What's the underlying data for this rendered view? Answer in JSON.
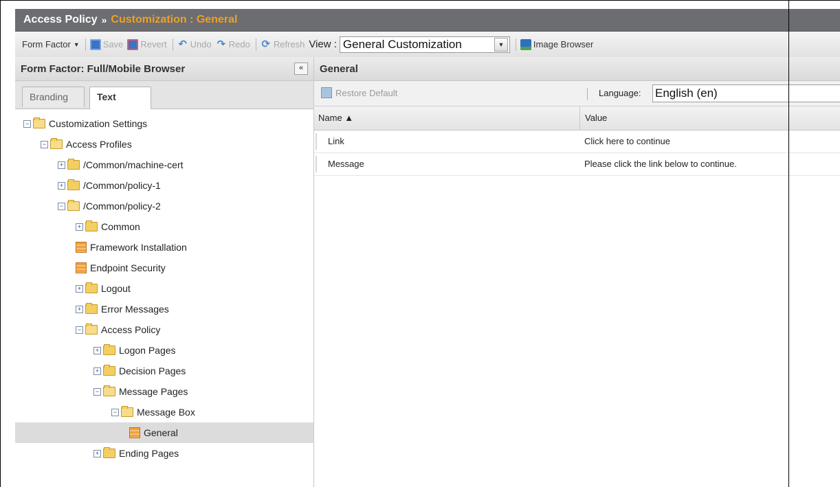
{
  "titlebar": {
    "section": "Access Policy",
    "separator": "»",
    "page": "Customization : General"
  },
  "toolbar": {
    "form_factor": "Form Factor",
    "save": "Save",
    "revert": "Revert",
    "undo": "Undo",
    "redo": "Redo",
    "refresh": "Refresh",
    "view_label": "View :",
    "view_value": "General Customization",
    "image_browser": "Image Browser"
  },
  "left_panel": {
    "title": "Form Factor: Full/Mobile Browser",
    "collapse_glyph": "«",
    "tabs": [
      "Branding",
      "Text"
    ],
    "active_tab": "Text"
  },
  "tree": [
    {
      "label": "Customization Settings",
      "level": 0,
      "type": "folder",
      "expanded": true
    },
    {
      "label": "Access Profiles",
      "level": 1,
      "type": "folder",
      "expanded": true
    },
    {
      "label": "/Common/machine-cert",
      "level": 2,
      "type": "folder",
      "expanded": false
    },
    {
      "label": "/Common/policy-1",
      "level": 2,
      "type": "folder",
      "expanded": false
    },
    {
      "label": "/Common/policy-2",
      "level": 2,
      "type": "folder",
      "expanded": true
    },
    {
      "label": "Common",
      "level": 3,
      "type": "folder",
      "expanded": false
    },
    {
      "label": "Framework Installation",
      "level": 3,
      "type": "page"
    },
    {
      "label": "Endpoint Security",
      "level": 3,
      "type": "page"
    },
    {
      "label": "Logout",
      "level": 3,
      "type": "folder",
      "expanded": false
    },
    {
      "label": "Error Messages",
      "level": 3,
      "type": "folder",
      "expanded": false
    },
    {
      "label": "Access Policy",
      "level": 3,
      "type": "folder",
      "expanded": true
    },
    {
      "label": "Logon Pages",
      "level": 4,
      "type": "folder",
      "expanded": false
    },
    {
      "label": "Decision Pages",
      "level": 4,
      "type": "folder",
      "expanded": false
    },
    {
      "label": "Message Pages",
      "level": 4,
      "type": "folder",
      "expanded": true
    },
    {
      "label": "Message Box",
      "level": 5,
      "type": "folder",
      "expanded": true
    },
    {
      "label": "General",
      "level": 6,
      "type": "page",
      "selected": true
    },
    {
      "label": "Ending Pages",
      "level": 4,
      "type": "folder",
      "expanded": false
    }
  ],
  "right_panel": {
    "title": "General",
    "restore_default": "Restore Default",
    "language_label": "Language:",
    "language_value": "English (en)",
    "columns": {
      "name": "Name ▲",
      "value": "Value"
    },
    "rows": [
      {
        "name": "Link",
        "value": "Click here to continue"
      },
      {
        "name": "Message",
        "value": "Please click the link below to continue."
      }
    ]
  },
  "colors": {
    "titlebar_bg": "#6b6d71",
    "title_accent": "#f0a020",
    "selection": "#dcdcdc"
  }
}
